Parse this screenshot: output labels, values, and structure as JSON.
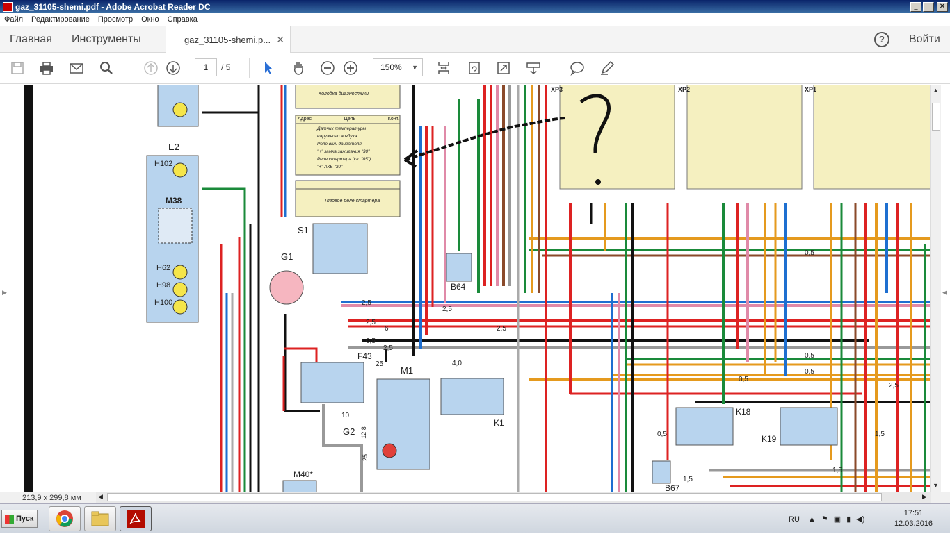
{
  "window": {
    "title": "gaz_31105-shemi.pdf - Adobe Acrobat Reader DC",
    "min": "_",
    "max": "❐",
    "close": "✕"
  },
  "menu": [
    "Файл",
    "Редактирование",
    "Просмотр",
    "Окно",
    "Справка"
  ],
  "tabs": {
    "home": "Главная",
    "tools": "Инструменты",
    "document": "gaz_31105-shemi.p...",
    "close": "✕",
    "help": "?",
    "login": "Войти"
  },
  "toolbar": {
    "icons": [
      "save-icon",
      "print-icon",
      "email-icon",
      "search-icon",
      "page-up-icon",
      "page-down-icon",
      "select-arrow-icon",
      "hand-icon",
      "zoom-out-icon",
      "zoom-in-icon",
      "fit-page-icon",
      "rotate-icon",
      "fullscreen-icon",
      "scroll-mode-icon",
      "comment-icon",
      "pen-icon"
    ],
    "page_current": "1",
    "page_total": "/ 5",
    "zoom": "150%"
  },
  "status": {
    "dimensions": "213,9 x 299,8 мм"
  },
  "schematic": {
    "labels": {
      "e2": "E2",
      "h102": "H102",
      "m38": "M38",
      "h62": "H62",
      "h98": "H98",
      "h100": "H100",
      "g1": "G1",
      "s1": "S1",
      "b64": "B64",
      "f43": "F43",
      "m1": "M1",
      "k1": "K1",
      "g2": "G2",
      "m40": "M40*",
      "k18": "K18",
      "k19": "K19",
      "b67": "B67"
    },
    "wire_labels": [
      "2,5",
      "2,5",
      "2,5",
      "6",
      "0,5",
      "2,5",
      "2,5",
      "4,0",
      "0,5",
      "0,5",
      "0,5",
      "0,5",
      "2,5",
      "1,5",
      "1,5",
      "0,5",
      "1,5",
      "25",
      "10",
      "12,8",
      "25"
    ],
    "table1_header": [
      "Адрес",
      "Цепь",
      "Конт."
    ],
    "table1_rows": [
      "Датчик температуры",
      "наружного воздуха",
      "Реле вкл. двигателя",
      "\"+\" замка зажигания \"30\"",
      "Реле стартера (кл. \"85\")",
      "\"+\" АКБ \"30\""
    ],
    "table2_row": "Тяговое реле стартера",
    "diag": "Колодка диагностики",
    "connectors": [
      "XP3",
      "XP2",
      "XP1"
    ],
    "annotation": "?"
  },
  "taskbar": {
    "start": "Пуск",
    "lang": "RU",
    "time": "17:51",
    "date": "12.03.2016"
  },
  "colors": {
    "titlebar": "#0a246a",
    "wire_red": "#d22",
    "wire_green": "#1a8a3a",
    "wire_blue": "#1e6fd0",
    "wire_pink": "#e08aa8",
    "wire_orange": "#e59a1e",
    "wire_brown": "#8a4a2a",
    "wire_grey": "#999",
    "component_fill": "#b8d4ee",
    "table_fill": "#f5f0c0"
  }
}
